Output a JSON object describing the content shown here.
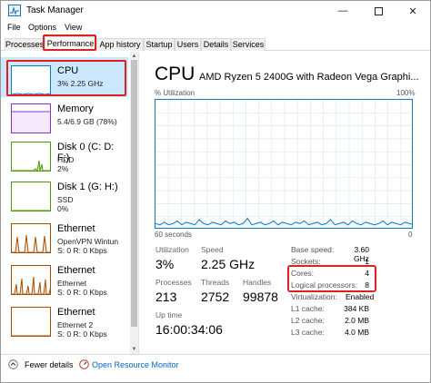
{
  "window": {
    "title": "Task Manager"
  },
  "menu": {
    "file": "File",
    "options": "Options",
    "view": "View"
  },
  "tabs": [
    "Processes",
    "Performance",
    "App history",
    "Startup",
    "Users",
    "Details",
    "Services"
  ],
  "sidebar": {
    "items": [
      {
        "name": "CPU",
        "sub": [
          "3%  2.25 GHz"
        ]
      },
      {
        "name": "Memory",
        "sub": [
          "5.4/6.9 GB (78%)"
        ]
      },
      {
        "name": "Disk 0 (C: D: F:)",
        "sub": [
          "HDD",
          "2%"
        ]
      },
      {
        "name": "Disk 1 (G: H:)",
        "sub": [
          "SSD",
          "0%"
        ]
      },
      {
        "name": "Ethernet",
        "sub": [
          "OpenVPN Wintun",
          "S: 0  R: 0 Kbps"
        ]
      },
      {
        "name": "Ethernet",
        "sub": [
          "Ethernet",
          "S: 0  R: 0 Kbps"
        ]
      },
      {
        "name": "Ethernet",
        "sub": [
          "Ethernet 2",
          "S: 0  R: 0 Kbps"
        ]
      }
    ]
  },
  "main": {
    "title": "CPU",
    "model": "AMD Ryzen 5 2400G with Radeon Vega Graphi...",
    "graph": {
      "ylabel": "% Utilization",
      "ymax_label": "100%",
      "xlabel_left": "60 seconds",
      "xlabel_right": "0",
      "utilization": [
        4,
        3,
        5,
        3,
        4,
        6,
        3,
        5,
        4,
        3,
        7,
        4,
        3,
        5,
        4,
        3,
        6,
        4,
        5,
        3,
        4,
        8,
        3,
        4,
        5,
        3,
        4,
        6,
        3,
        5,
        4,
        3,
        5,
        4,
        6,
        3,
        4,
        5,
        3,
        4,
        7,
        3,
        4,
        5,
        3,
        6,
        4,
        3,
        5,
        4,
        3,
        4,
        6,
        3,
        5,
        4,
        3,
        5,
        4,
        3
      ]
    },
    "stats": {
      "utilization_label": "Utilization",
      "utilization": "3%",
      "speed_label": "Speed",
      "speed": "2.25 GHz",
      "processes_label": "Processes",
      "processes": "213",
      "threads_label": "Threads",
      "threads": "2752",
      "handles_label": "Handles",
      "handles": "99878",
      "uptime_label": "Up time",
      "uptime": "16:00:34:06"
    },
    "specs": [
      {
        "label": "Base speed:",
        "value": "3.60 GHz"
      },
      {
        "label": "Sockets:",
        "value": "1"
      },
      {
        "label": "Cores:",
        "value": "4"
      },
      {
        "label": "Logical processors:",
        "value": "8"
      },
      {
        "label": "Virtualization:",
        "value": "Enabled"
      },
      {
        "label": "L1 cache:",
        "value": "384 KB"
      },
      {
        "label": "L2 cache:",
        "value": "2.0 MB"
      },
      {
        "label": "L3 cache:",
        "value": "4.0 MB"
      }
    ]
  },
  "footer": {
    "fewer_details": "Fewer details",
    "resource_monitor": "Open Resource Monitor"
  },
  "colors": {
    "cpu": "#1178bc",
    "memory": "#8b2fc9",
    "disk": "#4d9a06",
    "ethernet": "#a74f01",
    "selected": "#cce8ff",
    "highlight": "#e02020"
  }
}
